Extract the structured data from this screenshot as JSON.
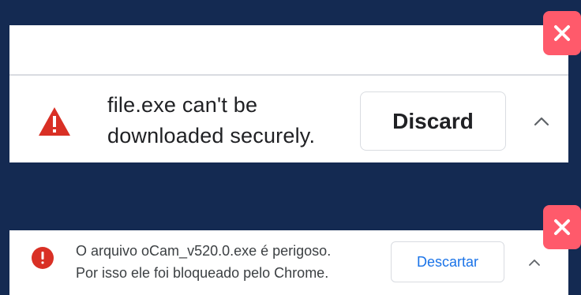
{
  "colors": {
    "background": "#142a52",
    "close_badge": "#ff5a6b",
    "warning_red": "#d93025",
    "link_blue": "#1a73e8"
  },
  "top_download_bar": {
    "icon": "warning-triangle-icon",
    "message_line1": "file.exe can't be",
    "message_line2": "downloaded securely.",
    "discard_label": "Discard",
    "expand_icon": "chevron-up-icon",
    "close_icon": "close-icon"
  },
  "bottom_download_bar": {
    "icon": "error-circle-icon",
    "message_line1": "O arquivo oCam_v520.0.exe é perigoso.",
    "message_line2": "Por isso ele foi bloqueado pelo Chrome.",
    "discard_label": "Descartar",
    "expand_icon": "chevron-up-icon",
    "close_icon": "close-icon"
  }
}
